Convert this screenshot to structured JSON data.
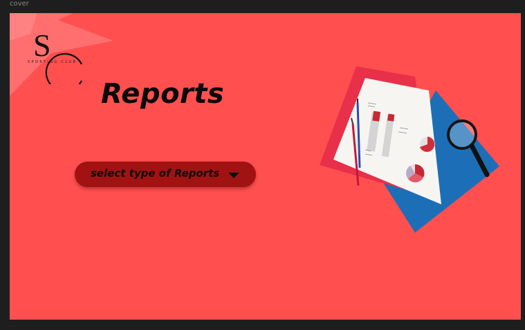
{
  "frame": {
    "label": "cover"
  },
  "brand": {
    "monogram": "SC",
    "name": "SPORTING CLUB",
    "logo_icon": "sporting-club-monogram-logo"
  },
  "page": {
    "title": "Reports"
  },
  "report_select": {
    "label": "select type of Reports",
    "icon": "caret-down-icon"
  },
  "illustration": {
    "icon": "reports-papers-magnifier-illustration"
  },
  "colors": {
    "background": "#ff4f4f",
    "button": "#a11313",
    "text": "#0a0a0a",
    "canvas": "#1e1e1e"
  }
}
